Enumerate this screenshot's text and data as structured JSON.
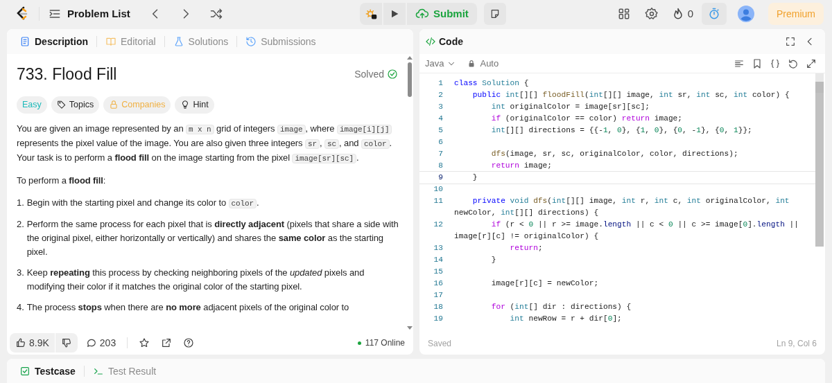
{
  "top_bar": {
    "problem_list": "Problem List",
    "submit": "Submit",
    "streak": "0",
    "premium": "Premium"
  },
  "description_panel": {
    "tabs": [
      {
        "label": "Description",
        "kind": "description",
        "selected": true
      },
      {
        "label": "Editorial",
        "kind": "editorial",
        "selected": false
      },
      {
        "label": "Solutions",
        "kind": "solutions",
        "selected": false
      },
      {
        "label": "Submissions",
        "kind": "submissions",
        "selected": false
      }
    ],
    "title": "733. Flood Fill",
    "status": "Solved",
    "tags": [
      {
        "label": "Easy",
        "kind": "difficulty"
      },
      {
        "label": "Topics",
        "kind": "topics"
      },
      {
        "label": "Companies",
        "kind": "companies"
      },
      {
        "label": "Hint",
        "kind": "hint"
      }
    ],
    "paragraphs": [
      [
        {
          "kind": "text",
          "text": "You are given an image represented by an "
        },
        {
          "kind": "code",
          "text": "m x n"
        },
        {
          "kind": "text",
          "text": " grid of integers "
        },
        {
          "kind": "code",
          "text": "image"
        },
        {
          "kind": "text",
          "text": ", where "
        },
        {
          "kind": "code",
          "text": "image[i][j]"
        },
        {
          "kind": "text",
          "text": " represents the pixel value of the image. You are also given three integers "
        },
        {
          "kind": "code",
          "text": "sr"
        },
        {
          "kind": "text",
          "text": ", "
        },
        {
          "kind": "code",
          "text": "sc"
        },
        {
          "kind": "text",
          "text": ", and "
        },
        {
          "kind": "code",
          "text": "color"
        },
        {
          "kind": "text",
          "text": ". Your task is to perform a **flood fill** on the image starting from the pixel "
        },
        {
          "kind": "code",
          "text": "image[sr][sc]"
        },
        {
          "kind": "text",
          "text": "."
        }
      ],
      [
        {
          "kind": "text",
          "text": "To perform a **flood fill**:"
        }
      ]
    ],
    "steps": [
      [
        {
          "kind": "text",
          "text": "Begin with the starting pixel and change its color to "
        },
        {
          "kind": "code",
          "text": "color"
        },
        {
          "kind": "text",
          "text": "."
        }
      ],
      [
        {
          "kind": "text",
          "text": "Perform the same process for each pixel that is **directly adjacent** (pixels that share a side with the original pixel, either horizontally or vertically) and shares the **same color** as the starting pixel."
        }
      ],
      [
        {
          "kind": "text",
          "text": "Keep **repeating** this process by checking neighboring pixels of the *updated* pixels and modifying their color if it matches the original color of the starting pixel."
        }
      ],
      [
        {
          "kind": "text",
          "text": "The process **stops** when there are **no more** adjacent pixels of the original color to"
        }
      ]
    ],
    "step_numbers": [
      "1.",
      "2.",
      "3.",
      "4."
    ],
    "likes": "8.9K",
    "comments": "203",
    "online": "117 Online"
  },
  "code_panel": {
    "title": "Code",
    "language": "Java",
    "mode": "Auto",
    "lines": [
      {
        "number": "1",
        "text": "class Solution {",
        "selected": false
      },
      {
        "number": "2",
        "text": "    public int[][] floodFill(int[][] image, int sr, int sc, int color) {",
        "selected": false
      },
      {
        "number": "3",
        "text": "        int originalColor = image[sr][sc];",
        "selected": false
      },
      {
        "number": "4",
        "text": "        if (originalColor == color) return image;",
        "selected": false
      },
      {
        "number": "5",
        "text": "        int[][] directions = {{-1, 0}, {1, 0}, {0, -1}, {0, 1}};",
        "selected": false
      },
      {
        "number": "6",
        "selected": false
      },
      {
        "number": "7",
        "text": "        dfs(image, sr, sc, originalColor, color, directions);",
        "selected": false
      },
      {
        "number": "8",
        "text": "        return image;",
        "selected": false
      },
      {
        "number": "9",
        "text": "    }",
        "selected": true
      },
      {
        "number": "10",
        "selected": false
      },
      {
        "number": "11",
        "text": "    private void dfs(int[][] image, int r, int c, int originalColor, int newColor, int[][] directions) {",
        "selected": false
      },
      {
        "number": "12",
        "text": "        if (r < 0 || r >= image.length || c < 0 || c >= image[0].length || image[r][c] != originalColor) {",
        "selected": false
      },
      {
        "number": "13",
        "text": "            return;",
        "selected": false
      },
      {
        "number": "14",
        "text": "        }",
        "selected": false
      },
      {
        "number": "15",
        "selected": false
      },
      {
        "number": "16",
        "text": "        image[r][c] = newColor;",
        "selected": false
      },
      {
        "number": "17",
        "selected": false
      },
      {
        "number": "18",
        "text": "        for (int[] dir : directions) {",
        "selected": false
      },
      {
        "number": "19",
        "text": "            int newRow = r + dir[0];",
        "selected": false
      }
    ],
    "status": "Saved",
    "cursor": "Ln 9, Col 6"
  },
  "bottom_panel": {
    "tabs": [
      {
        "label": "Testcase",
        "kind": "testcase",
        "selected": true
      },
      {
        "label": "Test Result",
        "kind": "result",
        "selected": false
      }
    ]
  }
}
